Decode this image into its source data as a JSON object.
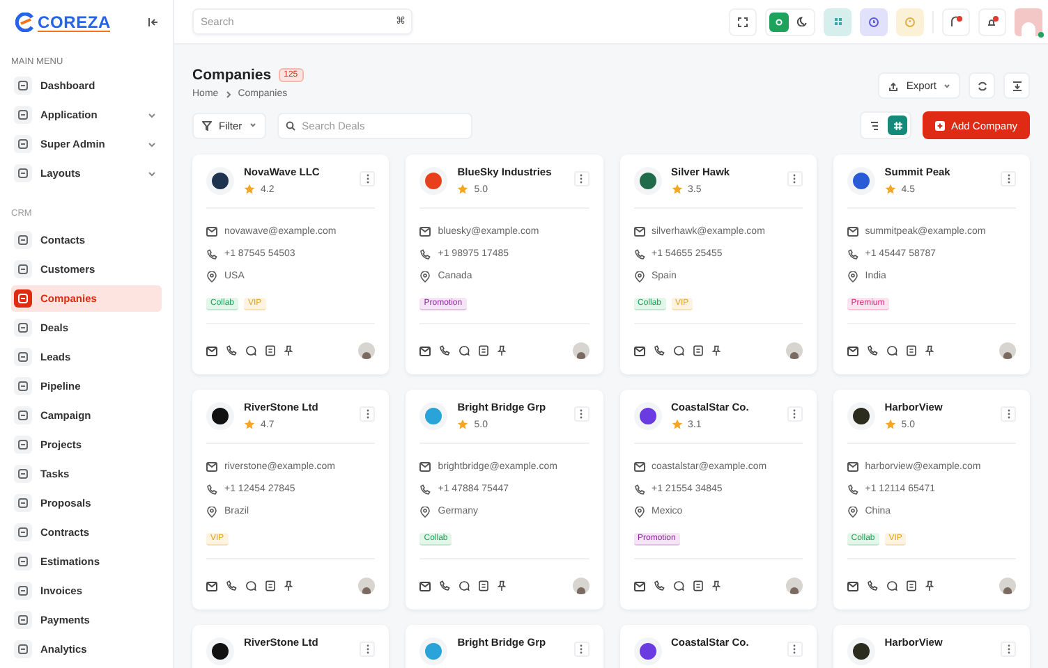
{
  "brand": {
    "name": "COREZA"
  },
  "sidebar": {
    "sections": [
      {
        "title": "MAIN MENU",
        "items": [
          {
            "label": "Dashboard",
            "selected": false
          },
          {
            "label": "Application",
            "selected": false,
            "expanded": false
          },
          {
            "label": "Super Admin",
            "selected": false,
            "expanded": false
          },
          {
            "label": "Layouts",
            "selected": false,
            "expanded": false
          }
        ]
      },
      {
        "title": "CRM",
        "items": [
          {
            "label": "Contacts",
            "selected": false
          },
          {
            "label": "Customers",
            "selected": false
          },
          {
            "label": "Companies",
            "selected": true
          },
          {
            "label": "Deals",
            "selected": false
          },
          {
            "label": "Leads",
            "selected": false
          },
          {
            "label": "Pipeline",
            "selected": false
          },
          {
            "label": "Campaign",
            "selected": false
          },
          {
            "label": "Projects",
            "selected": false
          },
          {
            "label": "Tasks",
            "selected": false
          },
          {
            "label": "Proposals",
            "selected": false
          },
          {
            "label": "Contracts",
            "selected": false
          },
          {
            "label": "Estimations",
            "selected": false
          },
          {
            "label": "Invoices",
            "selected": false
          },
          {
            "label": "Payments",
            "selected": false
          },
          {
            "label": "Analytics",
            "selected": false
          }
        ]
      }
    ]
  },
  "topbar": {
    "search": {
      "placeholder": "Search",
      "shortcut": "⌘"
    },
    "theme": {
      "light_selected": true
    }
  },
  "page": {
    "title": "Companies",
    "count": "125",
    "breadcrumbs": [
      "Home",
      "Companies"
    ],
    "export": "Export"
  },
  "toolbar": {
    "filter": "Filter",
    "search": {
      "placeholder": "Search Deals"
    },
    "view": {
      "grid_selected": true
    },
    "add_button": "Add Company"
  },
  "companies": [
    {
      "name": "NovaWave LLC",
      "color": "#1e3350",
      "rating": "4.2",
      "email": "novawave@example.com",
      "phone": "+1 87545 54503",
      "country": "USA",
      "tags": [
        {
          "label": "Collab",
          "kind": "collab"
        },
        {
          "label": "VIP",
          "kind": "vip"
        }
      ]
    },
    {
      "name": "BlueSky Industries",
      "color": "#e8401c",
      "rating": "5.0",
      "email": "bluesky@example.com",
      "phone": "+1 98975 17485",
      "country": "Canada",
      "tags": [
        {
          "label": "Promotion",
          "kind": "promotion"
        }
      ]
    },
    {
      "name": "Silver Hawk",
      "color": "#1f6b4a",
      "rating": "3.5",
      "email": "silverhawk@example.com",
      "phone": "+1 54655 25455",
      "country": "Spain",
      "tags": [
        {
          "label": "Collab",
          "kind": "collab"
        },
        {
          "label": "VIP",
          "kind": "vip"
        }
      ]
    },
    {
      "name": "Summit  Peak",
      "color": "#2a5bd7",
      "rating": "4.5",
      "email": "summitpeak@example.com",
      "phone": "+1 45447 58787",
      "country": "India",
      "tags": [
        {
          "label": "Premium",
          "kind": "premium"
        }
      ]
    },
    {
      "name": "RiverStone Ltd",
      "color": "#111111",
      "rating": "4.7",
      "email": "riverstone@example.com",
      "phone": "+1 12454 27845",
      "country": "Brazil",
      "tags": [
        {
          "label": "VIP",
          "kind": "vip"
        }
      ]
    },
    {
      "name": "Bright Bridge Grp",
      "color": "#2aa3d8",
      "rating": "5.0",
      "email": "brightbridge@example.com",
      "phone": "+1 47884 75447",
      "country": "Germany",
      "tags": [
        {
          "label": "Collab",
          "kind": "collab"
        }
      ]
    },
    {
      "name": "CoastalStar Co.",
      "color": "#6a3be0",
      "rating": "3.1",
      "email": "coastalstar@example.com",
      "phone": "+1 21554 34845",
      "country": "Mexico",
      "tags": [
        {
          "label": "Promotion",
          "kind": "promotion"
        }
      ]
    },
    {
      "name": "HarborView",
      "color": "#2b2b1e",
      "rating": "5.0",
      "email": "harborview@example.com",
      "phone": "+1 12114 65471",
      "country": "China",
      "tags": [
        {
          "label": "Collab",
          "kind": "collab"
        },
        {
          "label": "VIP",
          "kind": "vip"
        }
      ]
    },
    {
      "name": "RiverStone Ltd",
      "color": "#111111"
    },
    {
      "name": "Bright Bridge Grp",
      "color": "#2aa3d8"
    },
    {
      "name": "CoastalStar Co.",
      "color": "#6a3be0"
    },
    {
      "name": "HarborView",
      "color": "#2b2b1e"
    }
  ]
}
